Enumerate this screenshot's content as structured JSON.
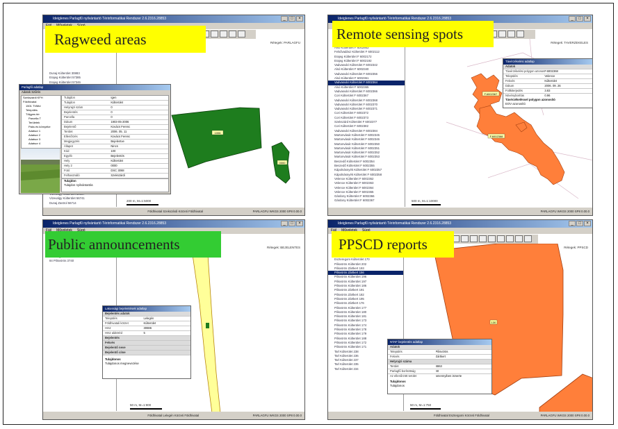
{
  "panels": {
    "ragweed": {
      "label": "Ragweed areas",
      "title": "Ideiglenes Parlagfű nyilvántartó Térinformatikai Rendszer 2.6.2316.28853",
      "menu": [
        "Fájl",
        "Műveletek",
        "Súgó"
      ],
      "map_info": "Rétegek: PARLAGFU",
      "list": [
        "Dunaj Kúlterület 30883",
        "Erajeg Kúlterület 57385",
        "Erajeg Kúlterület 57346",
        "Erajeg Kúlterület 57348",
        "Erajeg Kúlterület 57367",
        "Dunaj Zastrol 57368",
        "Dunaj Zastrol 58363",
        "Dunaj Zastrol 53442",
        "Dunaj Zastrol 57472"
      ],
      "list_bottom": [
        "Szinyeg Kúlterület 5750",
        "Vizevalgy Kúlterület 32767",
        "Vizevalgy Kúlterület 50667",
        "Vizevalgy Kúlterület 56741",
        "Dunaj Zastrol 56714"
      ],
      "parcel_label_1": "1006",
      "parcel_label_2": "0000",
      "scale": "200 m, M=1:5000",
      "status_center": "Földhivatal Szekszárdi Körzeti Földhivatal",
      "status_right": "PARLAGFU WKGS 2000 SP8 0.00.0",
      "dialog": {
        "title": "Parlagfű adatlap",
        "menu": "Adatok  Szűrés",
        "tree": [
          "Szekszárdi KFH",
          "Földhivatal",
          "1501 TVMid",
          "Település",
          "Tölgyes tér",
          "Parcella T",
          "Területek",
          "Paks és környéke",
          "Adatsor 1",
          "Adatsor 2",
          "Adatsor 3",
          "Adatsor 4"
        ],
        "rows": [
          [
            "Tulajdon",
            "Igen"
          ],
          [
            "Tulajdon",
            "Kúlterület"
          ],
          [
            "Helyrajzi szám",
            "0"
          ],
          [
            "Bejelentés",
            "0"
          ],
          [
            "Parcella",
            "0"
          ],
          [
            "Dátum",
            "1903-05-2006"
          ],
          [
            "Bejelentő",
            "Kovács Ferenc"
          ],
          [
            "Terület",
            "2006. 05. 11"
          ],
          [
            "Ellenőrzés",
            "Kovács Ferenc"
          ],
          [
            "Megjegyzés",
            "Bejelentve"
          ],
          [
            "Állapot",
            "Nincs"
          ],
          [
            "Kód",
            "100"
          ],
          [
            "Egyéb",
            "Bejelentés"
          ],
          [
            "Hely",
            "Kúlterület"
          ],
          [
            "Hely 2",
            "0000"
          ],
          [
            "Fotó",
            "DSC 3068"
          ],
          [
            "Felhasználó",
            "Szekszárdi"
          ]
        ],
        "footer_title": "Tulajdon",
        "footer_text": "Tulajdon nyilvántartás"
      }
    },
    "remote": {
      "label": "Remote sensing spots",
      "title": "Ideiglenes Parlagfű nyilvántartó Térinformatikai Rendszer 2.6.2316.28853",
      "map_info": "Rétegek: TAVERZEKELES",
      "list": [
        "Alsó Kúlterület F 6002863",
        "Felsővadász Kúlterület F 6002112",
        "Erajeg Kúlterület F 6002172",
        "Erajeg Kúlterület F 6002192",
        "Vadvasvári Kúlterület F 6002342",
        "Alsó Kúlterület F 6002340",
        "Vadvasvári Kúlterület F 6002356",
        "Alsó Kúlterület F 6002361",
        "Vadvasvári Kúlterület F 6002364",
        "Alsó Kúlterület F 6002365",
        "Vadvasvári Kúlterület F 6002366",
        "Cori Kúlterület F 6002367",
        "Vadvasvári Kúlterület F 6002368",
        "Vadvasvári Kúlterület F 6002370",
        "Vadvasvári Kúlterület F 6002371",
        "Cori Kúlterület F 6002372",
        "Cori Kúlterület F 6002373",
        "Szekszárd Kúlterület F 6002377",
        "Cori Kúlterület F 6002382",
        "Vadvasvári Kúlterület F 6002384",
        "Martonvásár Kúlterület F 6002345",
        "Martonvásár Kúlterület F 6002346",
        "Martonvásár Kúlterület F 6002350",
        "Martonvásár Kúlterület F 6002351",
        "Martonvásár Kúlterület F 6002352",
        "Martonvásár Kúlterület F 6002353",
        "Beszedő Kúlterület F 6002354",
        "Beszedő Kúlterület F 6002355",
        "Kápolnásnyék Kúlterület F 6002357",
        "Kápolnásnyék Kúlterület F 6002358",
        "Velence Kúlterület F 6002362",
        "Velence Kúlterület F 6002363",
        "Velence Kúlterület F 6002364",
        "Velence Kúlterület F 6002365",
        "Gárdony Kúlterület F 6002366",
        "Gárdony Kúlterület F 6002367"
      ],
      "spot_labels": [
        "F.6002367",
        "F.6002368"
      ],
      "scale": "500 m, M=1:10000",
      "status_right": "PARLAGFU WKGS 2000 SP8 0.00.0",
      "dialog": {
        "title": "Távérzékelési adatlap",
        "rows": [
          [
            "Adatok",
            ""
          ],
          [
            "Távérzékelési polygon azonosító",
            "F.6002368"
          ],
          [
            "Település",
            "Velence"
          ],
          [
            "Fekvés",
            "Kúlterület"
          ],
          [
            "Dátum",
            "2006. 09. 26"
          ],
          [
            "Foltkiterjedés",
            "3.83"
          ],
          [
            "Növényborítás",
            "0.96"
          ],
          [
            "Terület",
            "25440.00"
          ]
        ],
        "footer_title": "Távérzékeléssel polygon azonosító",
        "footer_text": "EOV azonosító"
      }
    },
    "public": {
      "label": "Public announcements",
      "title": "Ideiglenes Parlagfű nyilvántartó Térinformatikai Rendszer 2.6.2316.28853",
      "menu": [
        "Fájl",
        "Műveletek",
        "Súgó"
      ],
      "map_info": "Rétegek: BEJELENTES",
      "list": [
        "76 Lelegén 30887 1",
        "84 Pilisvörös 3740"
      ],
      "scale": "50 m, M=1:900",
      "status_center": "Földhivatal Lelegén Körzeti Földhivatal",
      "status_right": "PARLAGFU WKGS 2000 SP8 0.00.0",
      "dialog": {
        "title": "Lakossági bejelentések adatlap",
        "rows": [
          [
            "Bejelentés adatok",
            ""
          ],
          [
            "Település",
            "Lelegén"
          ],
          [
            "Földhivatali körzet",
            "Kúlterület"
          ],
          [
            "Hrsz",
            "30886"
          ],
          [
            "Hrsz alátöréd",
            "5"
          ],
          [
            "Bejelentés",
            ""
          ],
          [
            "Fekvés",
            ""
          ],
          [
            "Bejelentő neve",
            ""
          ],
          [
            "Bejelentő címe",
            ""
          ],
          [
            "Bejelentés tárgya",
            "parlagfüves rét terület"
          ]
        ],
        "footer_title": "Tulajdonos",
        "footer_text": "Tulajdonos megnevezése"
      }
    },
    "ppscd": {
      "label": "PPSCD reports",
      "title": "Ideiglenes Parlagfű nyilvántartó Térinformatikai Rendszer 2.6.2316.28853",
      "menu": [
        "Fájl",
        "Műveletek",
        "Súgó"
      ],
      "map_info": "Rétegek: PPSCD",
      "list": [
        "Eszteregom Kúlterület 66",
        "Eszteregom Kúlterület 170",
        "Pilisvörös Kúlterület 202",
        "Pilisvörös Zártkert 193",
        "Pilisvörös Zártkert 156",
        "Pilisvörös Kúlterület 196",
        "Pilisvörös Kúlterület 197",
        "Pilisvörös Kúlterület 186",
        "Pilisvörös Zártkert 191",
        "Pilisvörös Zártkert 182",
        "Pilisvörös Zártkert 195",
        "Pilisvörös Zártkert 176",
        "Pilisvörös Kúlterület 177",
        "Pilisvörös Kúlterület 180",
        "Pilisvörös Kúlterület 181",
        "Pilisvörös Kúlterület 173",
        "Pilisvörös Kúlterület 174",
        "Pilisvörös Kúlterület 178",
        "Pilisvörös Kúlterület 179",
        "Pilisvörös Kúlterület 188",
        "Pilisvörös Kúlterület 172",
        "Pilisvörös Kúlterület 171",
        "Tarl Kúlterület 238",
        "Tarl Kúlterület 236",
        "Tarl Kúlterület 237",
        "Tarl Kúlterület 235",
        "Tarl Kúlterület 234"
      ],
      "parcel_label": "130",
      "scale": "50 m, M=1:750",
      "status_center": "Földhivatal Esztergomi Körzeti Földhivatal",
      "status_right": "PARLAGFU WKGS 2000 SP8 0.00.0",
      "dialog": {
        "title": "NTAF bejelentés adatlap",
        "rows": [
          [
            "Adatok",
            ""
          ],
          [
            "Település",
            "Pilisvörös"
          ],
          [
            "Fekvés",
            "Zártkert"
          ],
          [
            "Helyrajzi száma",
            ""
          ],
          [
            "Terület",
            "8863"
          ],
          [
            "Parlagfű borítottság",
            "40"
          ],
          [
            "Az ellenőrzött terület",
            "amennyiben ismerte"
          ],
          [
            "A kultúrnövény faja",
            ""
          ]
        ],
        "footer_title": "Tulajdonos",
        "footer_text": "Tulajdonos"
      }
    }
  },
  "colors": {
    "label_yellow": "#ffff00",
    "label_green": "#33cc33",
    "ragweed_green": "#1e7d1e",
    "spot_orange": "#ff7f3a",
    "public_yellow": "#ffff99",
    "ppscd_orange": "#ff7f3a"
  }
}
